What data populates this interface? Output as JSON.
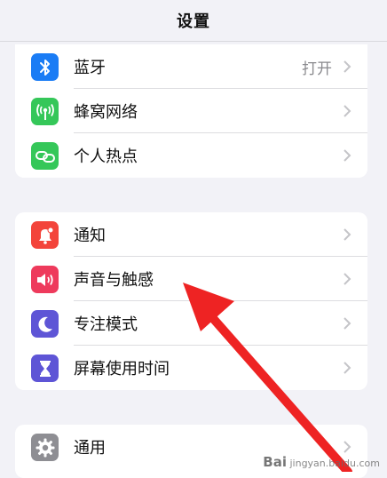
{
  "header": {
    "title": "设置"
  },
  "groups": [
    {
      "items": [
        {
          "label": "蓝牙",
          "value": "打开",
          "icon": "bluetooth-icon",
          "color": "#1a7cf5"
        },
        {
          "label": "蜂窝网络",
          "icon": "antenna-icon",
          "color": "#35c759"
        },
        {
          "label": "个人热点",
          "icon": "chain-link-icon",
          "color": "#35c759"
        }
      ]
    },
    {
      "items": [
        {
          "label": "通知",
          "icon": "bell-icon",
          "color": "#f3443b"
        },
        {
          "label": "声音与触感",
          "icon": "speaker-icon",
          "color": "#ee3a5c"
        },
        {
          "label": "专注模式",
          "icon": "moon-icon",
          "color": "#5e55d6"
        },
        {
          "label": "屏幕使用时间",
          "icon": "hourglass-icon",
          "color": "#5e55d6"
        }
      ]
    },
    {
      "items": [
        {
          "label": "通用",
          "icon": "gear-icon",
          "color": "#8e8e93"
        }
      ]
    }
  ],
  "annotation": {
    "arrow_color": "#ee2323"
  },
  "watermark": {
    "brand": "Bai",
    "text": "jingyan.baidu.com"
  }
}
